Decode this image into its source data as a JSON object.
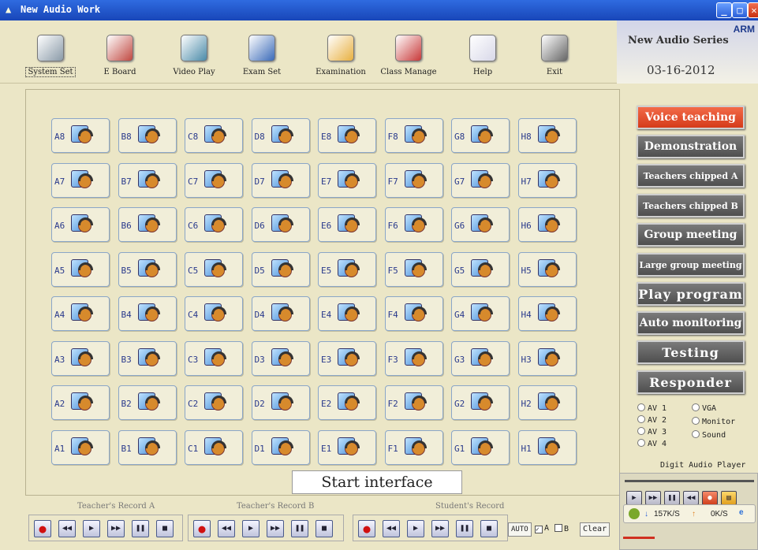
{
  "window": {
    "title": "New Audio Work"
  },
  "toolbar": [
    {
      "label": "System Set",
      "icon": "system-set-icon"
    },
    {
      "label": "E Board",
      "icon": "e-board-icon"
    },
    {
      "label": "Video Play",
      "icon": "video-play-icon"
    },
    {
      "label": "Exam Set",
      "icon": "exam-set-icon"
    },
    {
      "label": "Examination",
      "icon": "examination-icon"
    },
    {
      "label": "Class Manage",
      "icon": "class-manage-icon"
    },
    {
      "label": "Help",
      "icon": "help-icon"
    },
    {
      "label": "Exit",
      "icon": "exit-icon"
    }
  ],
  "brand": {
    "logo": "ARM",
    "series": "New Audio Series",
    "date": "03-16-2012"
  },
  "seat_columns": [
    "A",
    "B",
    "C",
    "D",
    "E",
    "F",
    "G",
    "H"
  ],
  "seat_rows": [
    "8",
    "7",
    "6",
    "5",
    "4",
    "3",
    "2",
    "1"
  ],
  "start_label": "Start interface",
  "modes": [
    "Voice teaching",
    "Demonstration",
    "Teachers chipped A",
    "Teachers chipped B",
    "Group meeting",
    "Large group meeting",
    "Play program",
    "Auto monitoring",
    "Testing",
    "Responder"
  ],
  "active_mode": "Voice teaching",
  "sources": {
    "left": [
      "AV 1",
      "AV 2",
      "AV 3",
      "AV 4"
    ],
    "right": [
      "VGA",
      "Monitor",
      "Sound"
    ]
  },
  "player": {
    "title": "Digit Audio Player"
  },
  "speed": {
    "down": "157K/S",
    "up": "0K/S"
  },
  "records": {
    "teacher_a": "Teacher's Record A",
    "teacher_b": "Teacher's Record B",
    "student": "Student's Record"
  },
  "record_controls": {
    "auto": "AUTO",
    "a": "A",
    "b": "B",
    "clear": "Clear"
  },
  "colors": {
    "active_mode": "#e5502e",
    "mode": "#666666",
    "title_bar": "#2456c8"
  }
}
